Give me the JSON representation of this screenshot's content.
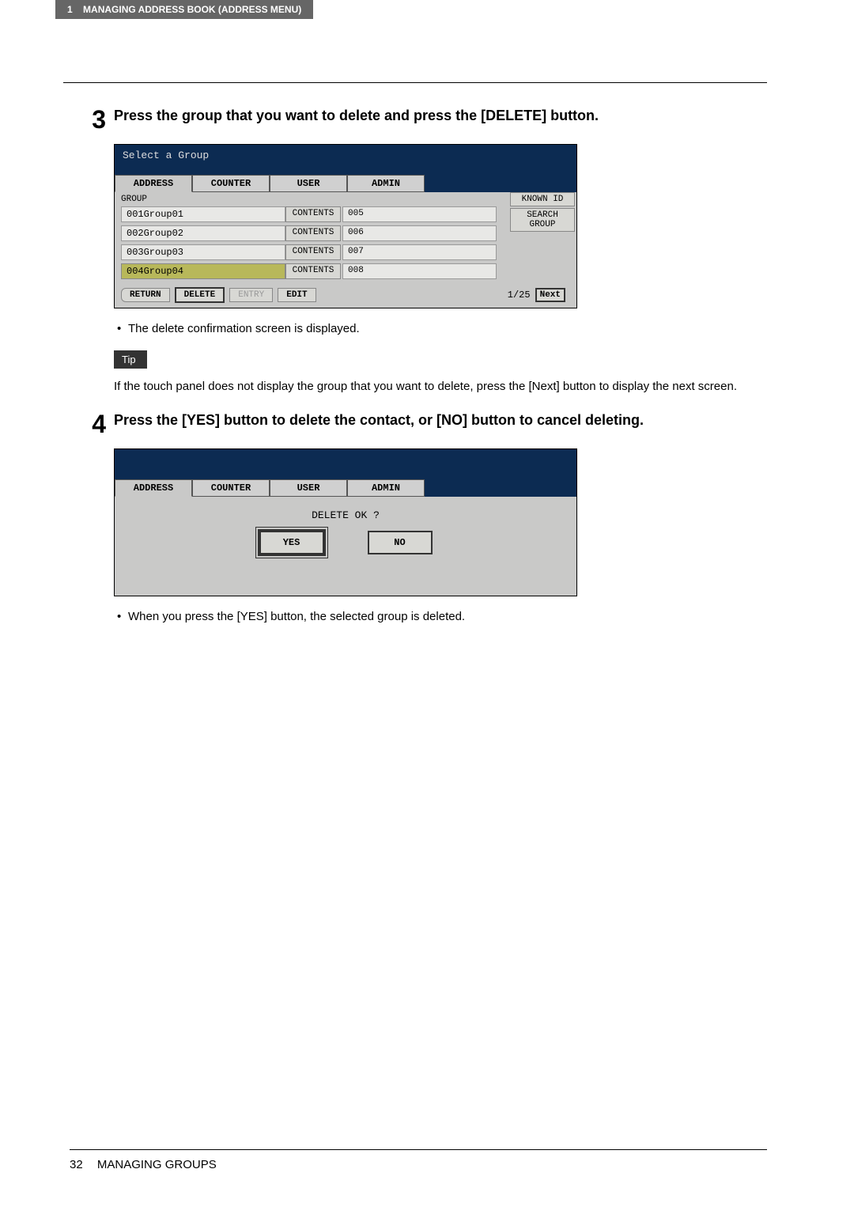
{
  "header": {
    "chapter_num": "1",
    "chapter_title": "MANAGING ADDRESS BOOK (ADDRESS MENU)"
  },
  "step3": {
    "number": "3",
    "title": "Press the group that you want to delete and press the [DELETE] button.",
    "bullet": "The delete confirmation screen is displayed."
  },
  "tip": {
    "label": "Tip",
    "text": "If the touch panel does not display the group that you want to delete, press the [Next] button to display the next screen."
  },
  "step4": {
    "number": "4",
    "title": "Press the [YES] button to delete the contact, or [NO] button to cancel deleting.",
    "bullet": "When you press the [YES] button, the selected group is deleted."
  },
  "screen1": {
    "title": "Select a Group",
    "tabs": [
      "ADDRESS",
      "COUNTER",
      "USER",
      "ADMIN"
    ],
    "group_label": "GROUP",
    "rows": [
      {
        "name": "001Group01",
        "contents": "CONTENTS",
        "count": "005",
        "selected": false
      },
      {
        "name": "002Group02",
        "contents": "CONTENTS",
        "count": "006",
        "selected": false
      },
      {
        "name": "003Group03",
        "contents": "CONTENTS",
        "count": "007",
        "selected": false
      },
      {
        "name": "004Group04",
        "contents": "CONTENTS",
        "count": "008",
        "selected": true
      }
    ],
    "side_buttons": [
      "KNOWN ID",
      "SEARCH GROUP"
    ],
    "footer": {
      "return": "RETURN",
      "delete": "DELETE",
      "entry": "ENTRY",
      "edit": "EDIT",
      "page": "1/25",
      "next": "Next"
    }
  },
  "screen2": {
    "tabs": [
      "ADDRESS",
      "COUNTER",
      "USER",
      "ADMIN"
    ],
    "delete_ok": "DELETE OK ?",
    "yes": "YES",
    "no": "NO"
  },
  "footer": {
    "page_number": "32",
    "section": "MANAGING GROUPS"
  }
}
